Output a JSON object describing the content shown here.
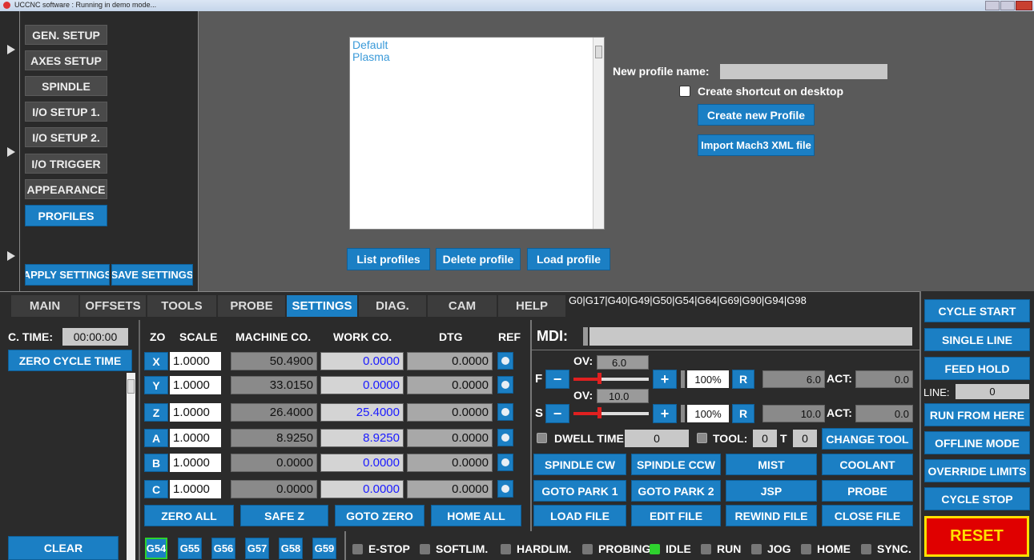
{
  "window": {
    "title": "UCCNC software : Running in demo mode..."
  },
  "settings_menu": {
    "items": [
      "GEN. SETUP",
      "AXES SETUP",
      "SPINDLE",
      "I/O SETUP 1.",
      "I/O SETUP 2.",
      "I/O TRIGGER",
      "APPEARANCE",
      "PROFILES"
    ],
    "active": "PROFILES",
    "apply": "APPLY SETTINGS",
    "save": "SAVE SETTINGS"
  },
  "profiles": {
    "list": [
      "Default",
      "Plasma"
    ],
    "new_name_label": "New profile name:",
    "new_name_value": "",
    "shortcut_label": "Create shortcut on desktop",
    "create": "Create new Profile",
    "import": "Import Mach3 XML file",
    "list_btn": "List profiles",
    "delete_btn": "Delete profile",
    "load_btn": "Load profile"
  },
  "tabs": [
    "MAIN",
    "OFFSETS",
    "TOOLS",
    "PROBE",
    "SETTINGS",
    "DIAG.",
    "CAM",
    "HELP"
  ],
  "active_tab": "SETTINGS",
  "gcodes": "G0|G17|G40|G49|G50|G54|G64|G69|G90|G94|G98",
  "cycle": {
    "time_label": "C. TIME:",
    "time_value": "00:00:00",
    "zero_btn": "ZERO CYCLE TIME",
    "clear_btn": "CLEAR"
  },
  "dro": {
    "headers": {
      "zo": "ZO",
      "scale": "SCALE",
      "machine": "MACHINE CO.",
      "work": "WORK CO.",
      "dtg": "DTG",
      "ref": "REF"
    },
    "axes": [
      {
        "name": "X",
        "scale": "1.0000",
        "machine": "50.4900",
        "work": "0.0000",
        "dtg": "0.0000"
      },
      {
        "name": "Y",
        "scale": "1.0000",
        "machine": "33.0150",
        "work": "0.0000",
        "dtg": "0.0000"
      },
      {
        "name": "Z",
        "scale": "1.0000",
        "machine": "26.4000",
        "work": "25.4000",
        "dtg": "0.0000"
      },
      {
        "name": "A",
        "scale": "1.0000",
        "machine": "8.9250",
        "work": "8.9250",
        "dtg": "0.0000"
      },
      {
        "name": "B",
        "scale": "1.0000",
        "machine": "0.0000",
        "work": "0.0000",
        "dtg": "0.0000"
      },
      {
        "name": "C",
        "scale": "1.0000",
        "machine": "0.0000",
        "work": "0.0000",
        "dtg": "0.0000"
      }
    ],
    "zero_all": "ZERO ALL",
    "safe_z": "SAFE Z",
    "goto_zero": "GOTO ZERO",
    "home_all": "HOME ALL"
  },
  "fixtures": [
    "G54",
    "G55",
    "G56",
    "G57",
    "G58",
    "G59"
  ],
  "active_fixture": "G54",
  "mdi": {
    "label": "MDI:",
    "value": ""
  },
  "feed": {
    "letter": "F",
    "ov_label": "OV:",
    "ov_value": "6.0",
    "percent": "100%",
    "reset": "R",
    "value": "6.0",
    "act_label": "ACT:",
    "act_value": "0.0",
    "minus": "−",
    "plus": "+"
  },
  "spindle": {
    "letter": "S",
    "ov_label": "OV:",
    "ov_value": "10.0",
    "percent": "100%",
    "reset": "R",
    "value": "10.0",
    "act_label": "ACT:",
    "act_value": "0.0",
    "minus": "−",
    "plus": "+"
  },
  "dwell": {
    "label": "DWELL TIME:",
    "value": "0",
    "tool_label": "TOOL:",
    "tool_value": "0",
    "t_label": "T",
    "t_value": "0",
    "change_tool": "CHANGE TOOL"
  },
  "actions": [
    [
      "SPINDLE CW",
      "SPINDLE CCW",
      "MIST",
      "COOLANT"
    ],
    [
      "GOTO PARK 1",
      "GOTO PARK 2",
      "JSP",
      "PROBE"
    ],
    [
      "LOAD FILE",
      "EDIT FILE",
      "REWIND FILE",
      "CLOSE FILE"
    ]
  ],
  "status": [
    {
      "label": "E-STOP",
      "on": false
    },
    {
      "label": "SOFTLIM.",
      "on": false
    },
    {
      "label": "HARDLIM.",
      "on": false
    },
    {
      "label": "PROBING",
      "on": false
    },
    {
      "label": "IDLE",
      "on": true
    },
    {
      "label": "RUN",
      "on": false
    },
    {
      "label": "JOG",
      "on": false
    },
    {
      "label": "HOME",
      "on": false
    },
    {
      "label": "SYNC.",
      "on": false
    }
  ],
  "right": {
    "cycle_start": "CYCLE START",
    "single_line": "SINGLE LINE",
    "feed_hold": "FEED HOLD",
    "line_label": "LINE:",
    "line_value": "0",
    "run_from_here": "RUN FROM HERE",
    "offline": "OFFLINE MODE",
    "override": "OVERRIDE LIMITS",
    "cycle_stop": "CYCLE STOP",
    "reset": "RESET"
  },
  "colors": {
    "accent": "#1b7fc4",
    "reset_bg": "#e00000",
    "reset_fg": "#ffe000",
    "led_on": "#2ed12e",
    "work_text": "#1a1aff"
  }
}
